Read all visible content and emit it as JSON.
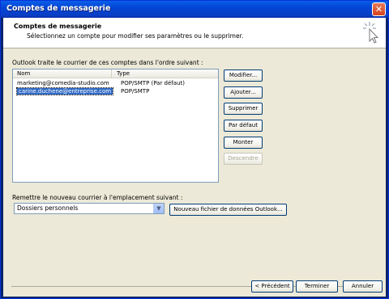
{
  "window": {
    "title": "Comptes de messagerie",
    "close_icon": "close-icon"
  },
  "header": {
    "title": "Comptes de messagerie",
    "subtitle": "Sélectionnez un compte pour modifier ses paramètres ou le supprimer.",
    "icon": "wizard-cursor-icon"
  },
  "accounts": {
    "label": "Outlook traite le courrier de ces comptes dans l'ordre suivant :",
    "columns": [
      "Nom",
      "Type"
    ],
    "rows": [
      {
        "name": "marketing@comedia-studio.com",
        "type": "POP/SMTP (Par défaut)",
        "selected": false
      },
      {
        "name": "carine.duchene@entreprise.com",
        "type": "POP/SMTP",
        "selected": true
      }
    ]
  },
  "side_buttons": {
    "modify": "Modifier...",
    "add": "Ajouter...",
    "remove": "Supprimer",
    "default": "Par défaut",
    "up": "Monter",
    "down": "Descendre"
  },
  "delivery": {
    "label": "Remettre le nouveau courrier à l'emplacement suivant :",
    "selected": "Dossiers personnels",
    "new_file_button": "Nouveau fichier de données Outlook..."
  },
  "footer": {
    "back": "< Précédent",
    "finish": "Terminer",
    "cancel": "Annuler"
  }
}
